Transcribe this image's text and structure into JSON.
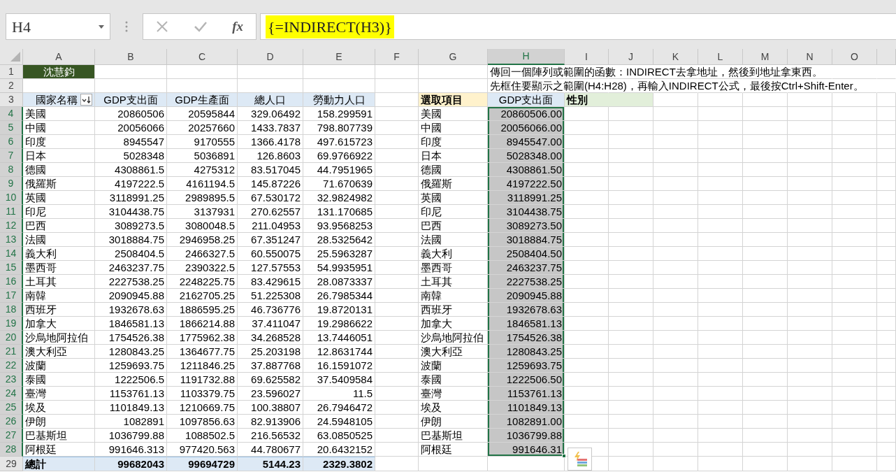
{
  "name_box": "H4",
  "formula_bar": {
    "function_label": "fx",
    "formula": "{=INDIRECT(H3)}",
    "highlighted": true
  },
  "columns": [
    {
      "label": "A",
      "selected": false
    },
    {
      "label": "B",
      "selected": false
    },
    {
      "label": "C",
      "selected": false
    },
    {
      "label": "D",
      "selected": false
    },
    {
      "label": "E",
      "selected": false
    },
    {
      "label": "F",
      "selected": false
    },
    {
      "label": "G",
      "selected": false
    },
    {
      "label": "H",
      "selected": true
    },
    {
      "label": "I",
      "selected": false
    },
    {
      "label": "J",
      "selected": false
    },
    {
      "label": "K",
      "selected": false
    },
    {
      "label": "L",
      "selected": false
    },
    {
      "label": "M",
      "selected": false
    },
    {
      "label": "N",
      "selected": false
    },
    {
      "label": "O",
      "selected": false
    }
  ],
  "rows": [
    {
      "label": "1",
      "selected": false
    },
    {
      "label": "2",
      "selected": false
    },
    {
      "label": "3",
      "selected": false
    },
    {
      "label": "4",
      "selected": true
    },
    {
      "label": "5",
      "selected": true
    },
    {
      "label": "6",
      "selected": true
    },
    {
      "label": "7",
      "selected": true
    },
    {
      "label": "8",
      "selected": true
    },
    {
      "label": "9",
      "selected": true
    },
    {
      "label": "10",
      "selected": true
    },
    {
      "label": "11",
      "selected": true
    },
    {
      "label": "12",
      "selected": true
    },
    {
      "label": "13",
      "selected": true
    },
    {
      "label": "14",
      "selected": true
    },
    {
      "label": "15",
      "selected": true
    },
    {
      "label": "16",
      "selected": true
    },
    {
      "label": "17",
      "selected": true
    },
    {
      "label": "18",
      "selected": true
    },
    {
      "label": "19",
      "selected": true
    },
    {
      "label": "20",
      "selected": true
    },
    {
      "label": "21",
      "selected": true
    },
    {
      "label": "22",
      "selected": true
    },
    {
      "label": "23",
      "selected": true
    },
    {
      "label": "24",
      "selected": true
    },
    {
      "label": "25",
      "selected": true
    },
    {
      "label": "26",
      "selected": true
    },
    {
      "label": "27",
      "selected": true
    },
    {
      "label": "28",
      "selected": true
    },
    {
      "label": "29",
      "selected": false
    }
  ],
  "author": "沈慧鈞",
  "notes": [
    "傳回一個陣列或範圍的函數：INDIRECT去拿地址，然後到地址拿東西。",
    "先框住要顯示之範圍(H4:H28)，再輸入INDIRECT公式，最後按Ctrl+Shift-Enter。"
  ],
  "pivot": {
    "headers": [
      "國家名稱",
      "GDP支出面",
      "GDP生產面",
      "總人口",
      "勞動力人口"
    ],
    "rows": [
      [
        "美國",
        "20860506",
        "20595844",
        "329.06492",
        "158.299591"
      ],
      [
        "中國",
        "20056066",
        "20257660",
        "1433.7837",
        "798.807739"
      ],
      [
        "印度",
        "8945547",
        "9170555",
        "1366.4178",
        "497.615723"
      ],
      [
        "日本",
        "5028348",
        "5036891",
        "126.8603",
        "69.9766922"
      ],
      [
        "德國",
        "4308861.5",
        "4275312",
        "83.517045",
        "44.7951965"
      ],
      [
        "俄羅斯",
        "4197222.5",
        "4161194.5",
        "145.87226",
        "71.670639"
      ],
      [
        "英國",
        "3118991.25",
        "2989895.5",
        "67.530172",
        "32.9824982"
      ],
      [
        "印尼",
        "3104438.75",
        "3137931",
        "270.62557",
        "131.170685"
      ],
      [
        "巴西",
        "3089273.5",
        "3080048.5",
        "211.04953",
        "93.9568253"
      ],
      [
        "法國",
        "3018884.75",
        "2946958.25",
        "67.351247",
        "28.5325642"
      ],
      [
        "義大利",
        "2508404.5",
        "2466327.5",
        "60.550075",
        "25.5963287"
      ],
      [
        "墨西哥",
        "2463237.75",
        "2390322.5",
        "127.57553",
        "54.9935951"
      ],
      [
        "土耳其",
        "2227538.25",
        "2248225.75",
        "83.429615",
        "28.0873337"
      ],
      [
        "南韓",
        "2090945.88",
        "2162705.25",
        "51.225308",
        "26.7985344"
      ],
      [
        "西班牙",
        "1932678.63",
        "1886595.25",
        "46.736776",
        "19.8720131"
      ],
      [
        "加拿大",
        "1846581.13",
        "1866214.88",
        "37.411047",
        "19.2986622"
      ],
      [
        "沙烏地阿拉伯",
        "1754526.38",
        "1775962.38",
        "34.268528",
        "13.7446051"
      ],
      [
        "澳大利亞",
        "1280843.25",
        "1364677.75",
        "25.203198",
        "12.8631744"
      ],
      [
        "波蘭",
        "1259693.75",
        "1211846.25",
        "37.887768",
        "16.1591072"
      ],
      [
        "泰國",
        "1222506.5",
        "1191732.88",
        "69.625582",
        "37.5409584"
      ],
      [
        "臺灣",
        "1153761.13",
        "1103379.75",
        "23.596027",
        "11.5"
      ],
      [
        "埃及",
        "1101849.13",
        "1210669.75",
        "100.38807",
        "26.7946472"
      ],
      [
        "伊朗",
        "1082891",
        "1097856.63",
        "82.913906",
        "24.5948105"
      ],
      [
        "巴基斯坦",
        "1036799.88",
        "1088502.5",
        "216.56532",
        "63.0850525"
      ],
      [
        "阿根廷",
        "991646.313",
        "977420.563",
        "44.780677",
        "20.6432152"
      ]
    ],
    "total": [
      "總計",
      "99682043",
      "99694729",
      "5144.23",
      "2329.3802"
    ]
  },
  "lookup": {
    "header": "選取項目",
    "items": [
      "美國",
      "中國",
      "印度",
      "日本",
      "德國",
      "俄羅斯",
      "英國",
      "印尼",
      "巴西",
      "法國",
      "義大利",
      "墨西哥",
      "土耳其",
      "南韓",
      "西班牙",
      "加拿大",
      "沙烏地阿拉伯",
      "澳大利亞",
      "波蘭",
      "泰國",
      "臺灣",
      "埃及",
      "伊朗",
      "巴基斯坦",
      "阿根廷"
    ]
  },
  "result": {
    "header": "GDP支出面",
    "selected": true,
    "values": [
      "20860506.00",
      "20056066.00",
      "8945547.00",
      "5028348.00",
      "4308861.50",
      "4197222.50",
      "3118991.25",
      "3104438.75",
      "3089273.50",
      "3018884.75",
      "2508404.50",
      "2463237.75",
      "2227538.25",
      "2090945.88",
      "1932678.63",
      "1846581.13",
      "1754526.38",
      "1280843.25",
      "1259693.75",
      "1222506.50",
      "1153761.13",
      "1101849.13",
      "1082891.00",
      "1036799.88",
      "991646.31"
    ]
  },
  "extra_header": "性別"
}
